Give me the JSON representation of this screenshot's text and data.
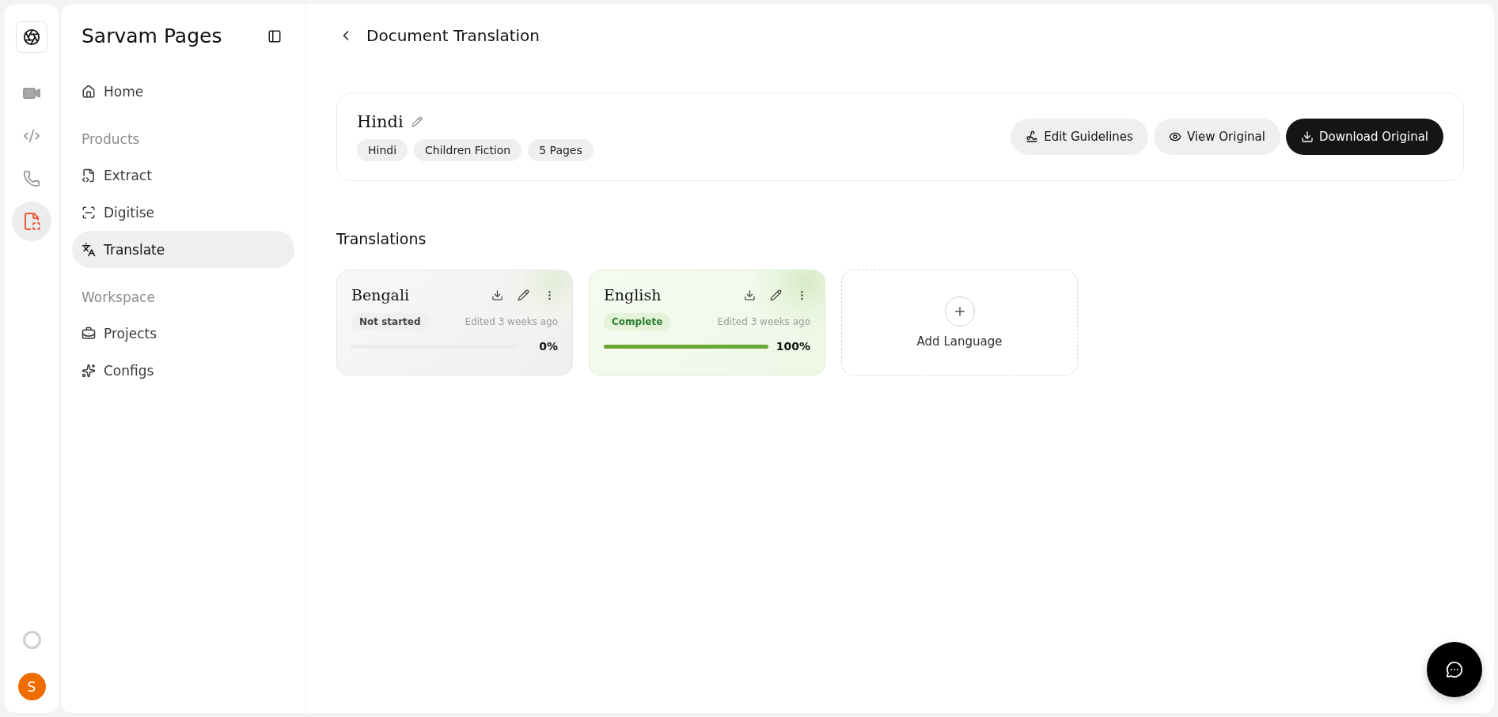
{
  "rail": {
    "items": [
      {
        "kind": "video",
        "selected": false
      },
      {
        "kind": "code",
        "selected": false
      },
      {
        "kind": "phone",
        "selected": false
      },
      {
        "kind": "document",
        "selected": true
      }
    ],
    "avatar": "S"
  },
  "sidebar": {
    "title": "Sarvam Pages",
    "items": [
      {
        "kind": "home",
        "label": "Home",
        "selected": false
      },
      {
        "kind": "section",
        "label": "Products"
      },
      {
        "kind": "extract",
        "label": "Extract",
        "selected": false
      },
      {
        "kind": "digitise",
        "label": "Digitise",
        "selected": false
      },
      {
        "kind": "translate",
        "label": "Translate",
        "selected": true
      },
      {
        "kind": "section",
        "label": "Workspace"
      },
      {
        "kind": "projects",
        "label": "Projects",
        "selected": false
      },
      {
        "kind": "configs",
        "label": "Configs",
        "selected": false
      }
    ]
  },
  "header": {
    "title": "Document Translation"
  },
  "document": {
    "name": "Hindi",
    "tags": [
      "Hindi",
      "Children Fiction",
      "5 Pages"
    ],
    "buttons": [
      {
        "kind": "guidelines",
        "label": "Edit Guidelines"
      },
      {
        "kind": "view",
        "label": "View Original"
      },
      {
        "kind": "download",
        "label": "Download Original"
      }
    ]
  },
  "translations": {
    "title": "Translations",
    "cards": [
      {
        "language": "Bengali",
        "kind": "pending",
        "status_label": "Not started",
        "edited": "Edited 3 weeks ago",
        "level": 0,
        "percent": "0%"
      },
      {
        "language": "English",
        "kind": "complete",
        "status_label": "Complete",
        "edited": "Edited 3 weeks ago",
        "level": 1,
        "percent": "100%"
      }
    ],
    "add_label": "Add Language"
  }
}
